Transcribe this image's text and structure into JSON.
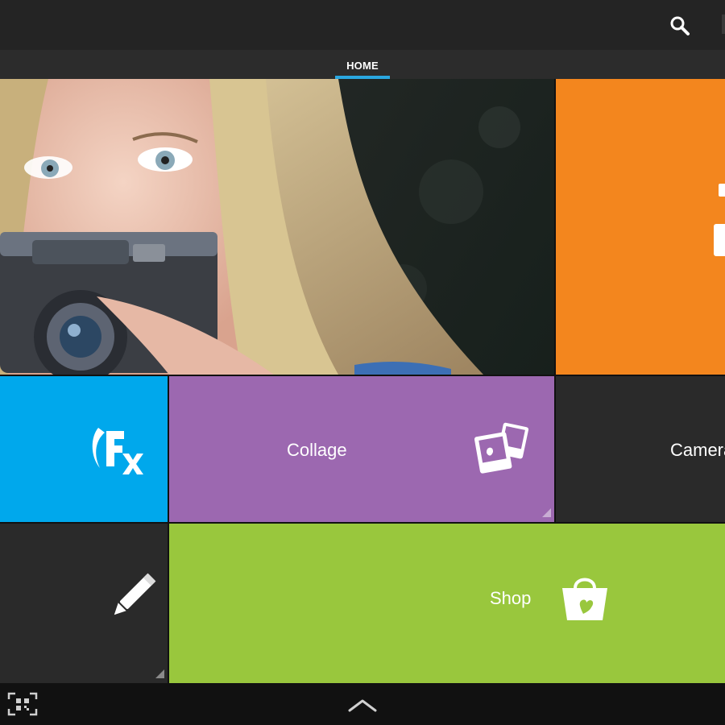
{
  "header": {
    "search_icon": "search-icon"
  },
  "tabs": [
    {
      "label": "HOME",
      "active": true
    }
  ],
  "tiles": {
    "photo": {
      "icon": "photo-featured"
    },
    "effects": {
      "icon": "fx-icon"
    },
    "collage": {
      "label": "Collage",
      "icon": "collage-photos-icon"
    },
    "camera": {
      "label": "Camera"
    },
    "draw": {
      "icon": "pencil-icon"
    },
    "shop": {
      "label": "Shop",
      "icon": "shopping-bag-icon"
    }
  },
  "colors": {
    "topbar": "#242424",
    "tab_indicator": "#2aa7e0",
    "orange": "#f3861e",
    "blue": "#00a8ec",
    "purple": "#9c68b0",
    "dark": "#2a2a2a",
    "green": "#99c73d"
  },
  "footer": {
    "left_icon": "qr-scan-icon",
    "center_icon": "chevron-up-icon"
  }
}
